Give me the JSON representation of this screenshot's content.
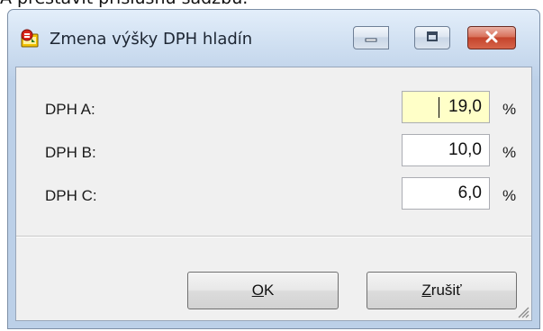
{
  "page_caption": "A prestaviť príslušnú sadzbu.",
  "window": {
    "title": "Zmena výšky DPH hladín",
    "icon": "app-window-icon"
  },
  "title_buttons": {
    "minimize": "minimize-icon",
    "maximize": "maximize-icon",
    "close": "close-icon"
  },
  "fields": [
    {
      "label": "DPH A:",
      "value": "19,0",
      "unit": "%"
    },
    {
      "label": "DPH B:",
      "value": "10,0",
      "unit": "%"
    },
    {
      "label": "DPH C:",
      "value": "6,0",
      "unit": "%"
    }
  ],
  "buttons": {
    "ok": {
      "mnemonic": "O",
      "rest": "K"
    },
    "cancel": {
      "mnemonic": "Z",
      "rest": "rušiť"
    }
  },
  "colors": {
    "focused_input": "#ffffc8",
    "close_button": "#c4442c",
    "title_bar": "#bcd0e8"
  }
}
